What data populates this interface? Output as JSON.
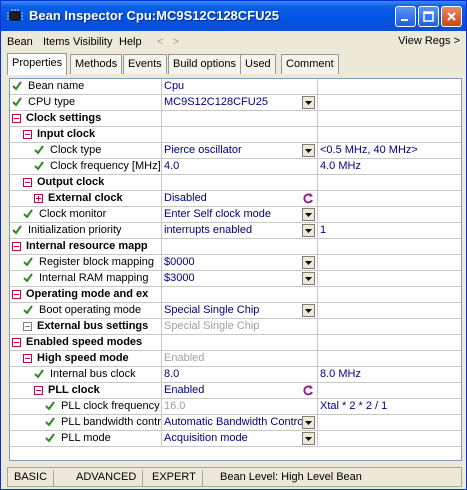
{
  "window": {
    "title": "Bean Inspector Cpu:MC9S12C128CFU25",
    "title_icon": "chip-icon",
    "titlebar_color": "#0054e3"
  },
  "menu": {
    "items": [
      "Bean",
      "Items Visibility",
      "Help"
    ],
    "nav_back": "<",
    "nav_fwd": ">",
    "view_regs": "View Regs >"
  },
  "tabs": [
    "Properties",
    "Methods",
    "Events",
    "Build options",
    "Used",
    "Comment"
  ],
  "rows": [
    {
      "name": "Bean name",
      "value": "Cpu",
      "ext": ""
    },
    {
      "name": "CPU type",
      "value": "MC9S12C128CFU25",
      "ext": ""
    },
    {
      "name": "Clock settings",
      "value": "",
      "ext": ""
    },
    {
      "name": "Input clock",
      "value": "",
      "ext": ""
    },
    {
      "name": "Clock type",
      "value": "Pierce oscillator",
      "ext": "<0.5 MHz, 40 MHz>"
    },
    {
      "name": "Clock frequency [MHz]",
      "value": "4.0",
      "ext": "4.0 MHz"
    },
    {
      "name": "Output clock",
      "value": "",
      "ext": ""
    },
    {
      "name": "External clock",
      "value": "Disabled",
      "ext": ""
    },
    {
      "name": "Clock monitor",
      "value": "Enter Self clock mode",
      "ext": ""
    },
    {
      "name": "Initialization priority",
      "value": "interrupts enabled",
      "ext": "1"
    },
    {
      "name": "Internal resource mapp",
      "value": "",
      "ext": ""
    },
    {
      "name": "Register block mapping",
      "value": "$0000",
      "ext": ""
    },
    {
      "name": "Internal RAM mapping",
      "value": "$3000",
      "ext": ""
    },
    {
      "name": "Operating mode and ex",
      "value": "",
      "ext": ""
    },
    {
      "name": "Boot operating mode",
      "value": "Special Single Chip",
      "ext": ""
    },
    {
      "name": "External bus settings",
      "value": "Special Single Chip",
      "ext": ""
    },
    {
      "name": "Enabled speed modes",
      "value": "",
      "ext": ""
    },
    {
      "name": "High speed mode",
      "value": "Enabled",
      "ext": ""
    },
    {
      "name": "Internal bus clock",
      "value": "8.0",
      "ext": "8.0 MHz"
    },
    {
      "name": "PLL clock",
      "value": "Enabled",
      "ext": ""
    },
    {
      "name": "PLL clock frequency",
      "value": "16.0",
      "ext": "Xtal * 2 * 2 / 1"
    },
    {
      "name": "PLL bandwidth contr",
      "value": "Automatic Bandwidth Control",
      "ext": ""
    },
    {
      "name": "PLL mode",
      "value": "Acquisition mode",
      "ext": ""
    }
  ],
  "bottom": {
    "tabs": [
      "BASIC",
      "ADVANCED",
      "EXPERT"
    ],
    "bean_level": "Bean Level: High Level Bean"
  },
  "colors": {
    "check": "#2e8b20",
    "minus_box": "#c0004a",
    "value_text": "#000080",
    "disabled_text": "#a0a0a0"
  }
}
